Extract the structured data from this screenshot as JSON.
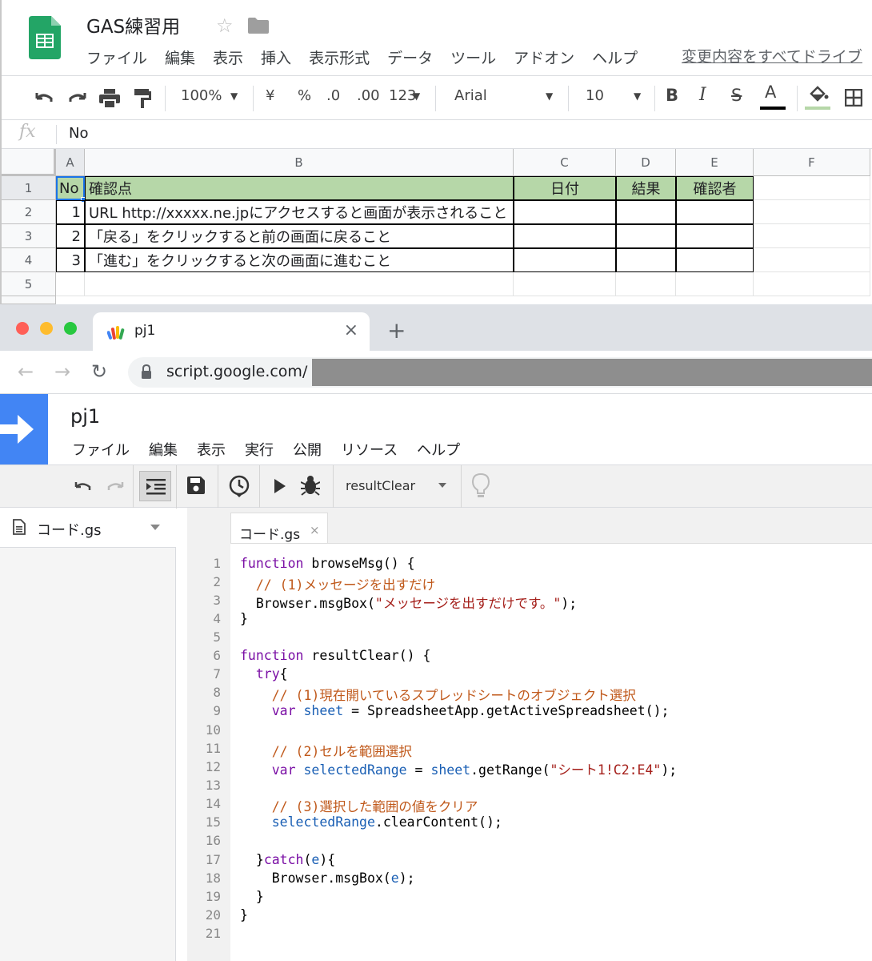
{
  "sheets": {
    "title": "GAS練習用",
    "menu": [
      "ファイル",
      "編集",
      "表示",
      "挿入",
      "表示形式",
      "データ",
      "ツール",
      "アドオン",
      "ヘルプ"
    ],
    "save_status": "変更内容をすべてドライブ",
    "toolbar": {
      "zoom": "100%",
      "currency": "¥",
      "percent": "%",
      "dec_less": ".0",
      "dec_more": ".00",
      "format_more": "123",
      "font": "Arial",
      "font_size": "10",
      "bold": "B",
      "italic": "I",
      "strike": "S",
      "text_color": "A"
    },
    "formula_bar": {
      "fx": "fx",
      "value": "No"
    },
    "columns": [
      "A",
      "B",
      "C",
      "D",
      "E",
      "F"
    ],
    "rows": [
      "1",
      "2",
      "3",
      "4",
      "5"
    ],
    "header": {
      "no": "No",
      "check": "確認点",
      "date": "日付",
      "result": "結果",
      "checker": "確認者"
    },
    "data": [
      {
        "no": "1",
        "check": "URL http://xxxxx.ne.jpにアクセスすると画面が表示されること"
      },
      {
        "no": "2",
        "check": "「戻る」をクリックすると前の画面に戻ること"
      },
      {
        "no": "3",
        "check": "「進む」をクリックすると次の画面に進むこと"
      }
    ],
    "header_color": "#b6d7a8"
  },
  "browser": {
    "tab_title": "pj1",
    "tab_close": "×",
    "new_tab": "+",
    "url": "script.google.com/"
  },
  "gas": {
    "project_title": "pj1",
    "menu": [
      "ファイル",
      "編集",
      "表示",
      "実行",
      "公開",
      "リソース",
      "ヘルプ"
    ],
    "function_select": "resultClear",
    "file_name": "コード.gs",
    "editor_tab": "コード.gs",
    "editor_tab_close": "×",
    "line_numbers": [
      "1",
      "2",
      "3",
      "4",
      "5",
      "6",
      "7",
      "8",
      "9",
      "10",
      "11",
      "12",
      "13",
      "14",
      "15",
      "16",
      "17",
      "18",
      "19",
      "20",
      "21"
    ],
    "code": {
      "l1_kw": "function",
      "l1_rest": " browseMsg() {",
      "l2": "  // (1)メッセージを出すだけ",
      "l3_a": "  Browser.msgBox(",
      "l3_str": "\"メッセージを出すだけです。\"",
      "l3_b": ");",
      "l4": "}",
      "l6_kw": "function",
      "l6_rest": " resultClear() {",
      "l7_kw": "  try",
      "l7_rest": "{",
      "l8": "    // (1)現在開いているスプレッドシートのオブジェクト選択",
      "l9_kw": "    var",
      "l9_var": " sheet",
      "l9_rest": " = SpreadsheetApp.getActiveSpreadsheet();",
      "l11": "    // (2)セルを範囲選択",
      "l12_kw": "    var",
      "l12_var": " selectedRange",
      "l12_mid": " = ",
      "l12_var2": "sheet",
      "l12_b": ".getRange(",
      "l12_str": "\"シート1!C2:E4\"",
      "l12_c": ");",
      "l14": "    // (3)選択した範囲の値をクリア",
      "l15_var": "    selectedRange",
      "l15_rest": ".clearContent();",
      "l17_a": "  }",
      "l17_kw": "catch",
      "l17_b": "(",
      "l17_var": "e",
      "l17_c": "){",
      "l18_a": "    Browser.msgBox(",
      "l18_var": "e",
      "l18_b": ");",
      "l19": "  }",
      "l20": "}"
    }
  }
}
